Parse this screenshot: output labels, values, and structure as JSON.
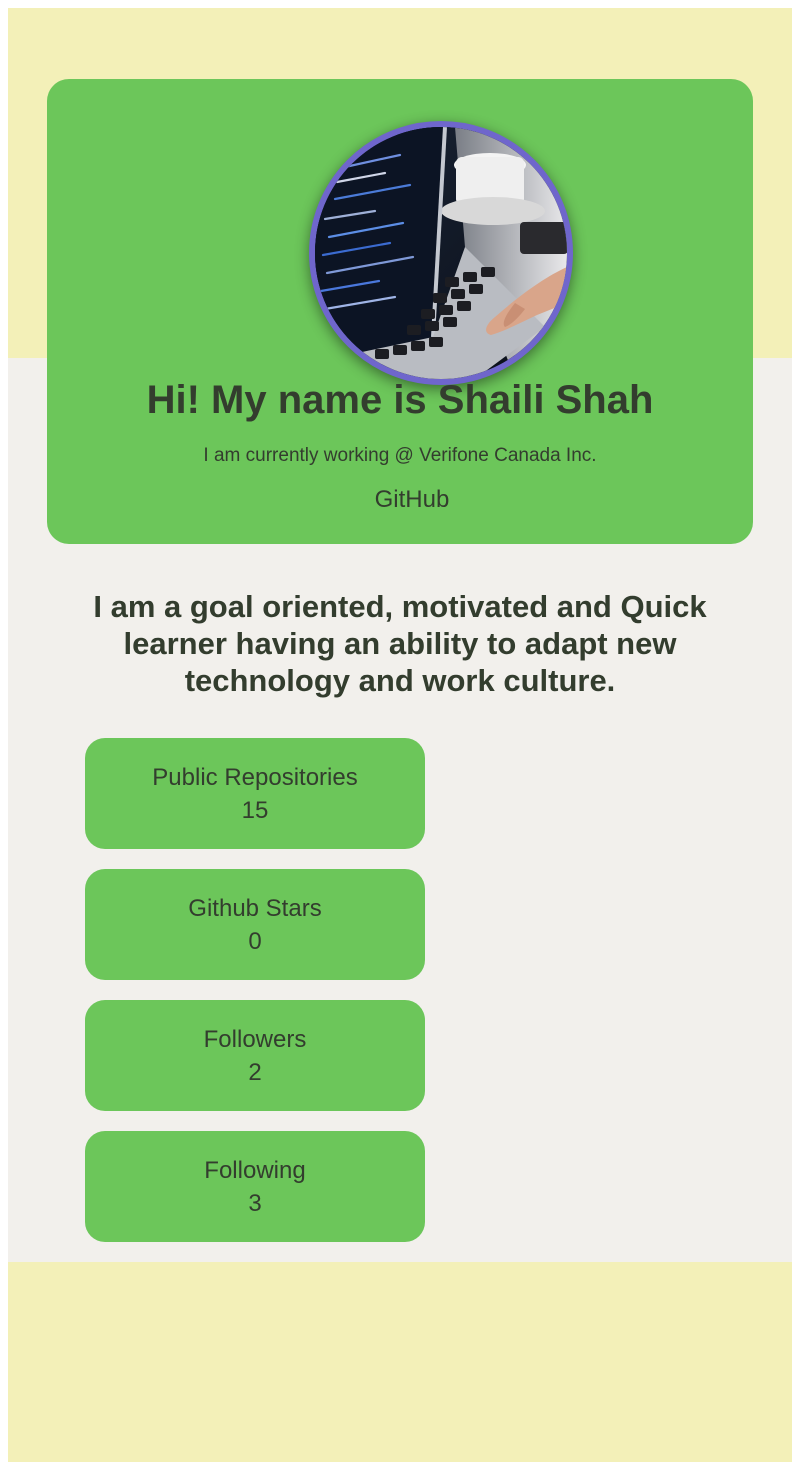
{
  "profile": {
    "avatar_alt": "laptop-coding-photo",
    "heading": "Hi! My name is Shaili Shah",
    "work": "I am currently working @ Verifone Canada Inc.",
    "github_link": "GitHub"
  },
  "bio": "I am a goal oriented, motivated and Quick learner having an ability to adapt new technology and work culture.",
  "stats": [
    {
      "label": "Public Repositories",
      "value": "15"
    },
    {
      "label": "Github Stars",
      "value": "0"
    },
    {
      "label": "Followers",
      "value": "2"
    },
    {
      "label": "Following",
      "value": "3"
    }
  ],
  "colors": {
    "card_green": "#6cc65a",
    "band_yellow": "#f3f0b8",
    "page_bg": "#f2f0ec",
    "text_dark": "#333d2e",
    "avatar_ring": "#6f66cc"
  }
}
